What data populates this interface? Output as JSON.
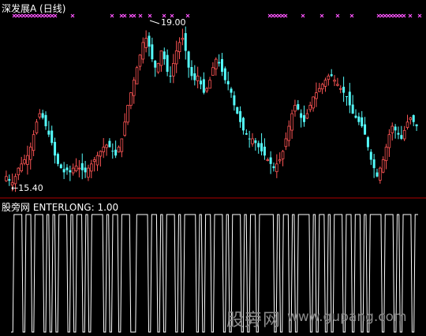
{
  "main_panel": {
    "title": "深发展A (日线)",
    "high_label": "19.00",
    "low_label": "←15.40",
    "high_marker_shape": "arrow",
    "up_color": "#ff5555",
    "down_color": "#54fcfc",
    "signal_color": "#ff55ff"
  },
  "sub_panel": {
    "title": "股旁网 ENTERLONG: 1.00",
    "line_color": "#ffffff"
  },
  "watermark": {
    "site": "股旁网",
    "url": "www.gupang.com"
  },
  "chart_data": [
    {
      "type": "candlestick",
      "title": "深发展A (日线)",
      "annotations": [
        "19.00",
        "←15.40"
      ],
      "ylim": [
        15.2,
        19.4
      ],
      "closes": [
        15.6,
        15.5,
        15.45,
        15.6,
        15.8,
        15.9,
        16.0,
        16.1,
        16.3,
        16.6,
        16.9,
        17.1,
        17.0,
        16.8,
        16.6,
        16.4,
        16.1,
        15.9,
        15.8,
        15.7,
        15.75,
        15.7,
        15.8,
        15.85,
        15.8,
        15.75,
        15.7,
        15.8,
        15.9,
        16.0,
        16.1,
        16.2,
        16.3,
        16.35,
        16.3,
        16.2,
        16.1,
        16.3,
        16.5,
        16.9,
        17.3,
        17.6,
        17.9,
        18.2,
        18.5,
        18.8,
        18.9,
        18.7,
        18.4,
        18.2,
        18.3,
        18.6,
        18.4,
        18.1,
        18.0,
        18.3,
        18.6,
        18.8,
        18.9,
        18.6,
        18.2,
        18.0,
        17.9,
        18.0,
        17.8,
        17.6,
        17.7,
        17.9,
        18.2,
        18.4,
        18.3,
        18.1,
        17.9,
        17.8,
        17.6,
        17.3,
        17.1,
        16.9,
        16.7,
        16.6,
        16.5,
        16.5,
        16.4,
        16.3,
        16.2,
        16.1,
        16.0,
        15.9,
        15.8,
        15.9,
        16.0,
        16.2,
        16.5,
        16.8,
        17.1,
        17.3,
        17.2,
        17.0,
        16.9,
        17.1,
        17.3,
        17.5,
        17.6,
        17.7,
        17.8,
        17.9,
        18.0,
        18.0,
        17.9,
        17.8,
        17.7,
        17.6,
        17.5,
        17.3,
        17.1,
        17.0,
        16.9,
        16.8,
        16.6,
        16.3,
        16.0,
        15.8,
        15.6,
        15.8,
        16.0,
        16.3,
        16.6,
        16.8,
        16.7,
        16.6,
        16.5,
        16.7,
        16.9,
        17.0,
        16.9,
        16.8
      ],
      "signal_markers": "magenta x marks along top edge"
    },
    {
      "type": "line",
      "title": "股旁网 ENTERLONG: 1.00",
      "series": [
        {
          "values": [
            0,
            1,
            1,
            1,
            0,
            1,
            1,
            0,
            1,
            1,
            1,
            0,
            1,
            0,
            1,
            0,
            1,
            1,
            1,
            0,
            1,
            0,
            1,
            1,
            0,
            1,
            0,
            1,
            1,
            1,
            1,
            0,
            1,
            0,
            1,
            1,
            0,
            1,
            1,
            1,
            0,
            0,
            1,
            1,
            1,
            1,
            0,
            1,
            1,
            0,
            1,
            0,
            1,
            1,
            1,
            0,
            1,
            0,
            1,
            1,
            1,
            1,
            0,
            1,
            0,
            1,
            1,
            0,
            1,
            1,
            1,
            0,
            1,
            0,
            1,
            1,
            1,
            0,
            1,
            0,
            1,
            1,
            0,
            1,
            1,
            1,
            1,
            1,
            0,
            1,
            0,
            1,
            1,
            0,
            1,
            0,
            1,
            1,
            1,
            1,
            0,
            1,
            0,
            1,
            1,
            0,
            1,
            0,
            1,
            1,
            1,
            0,
            1,
            1,
            0,
            1,
            1,
            0,
            1,
            0,
            1,
            1,
            1,
            1,
            0,
            1,
            1,
            1,
            0,
            1,
            0,
            1,
            1,
            1,
            0,
            1
          ]
        }
      ],
      "ylim": [
        0,
        1
      ]
    }
  ]
}
